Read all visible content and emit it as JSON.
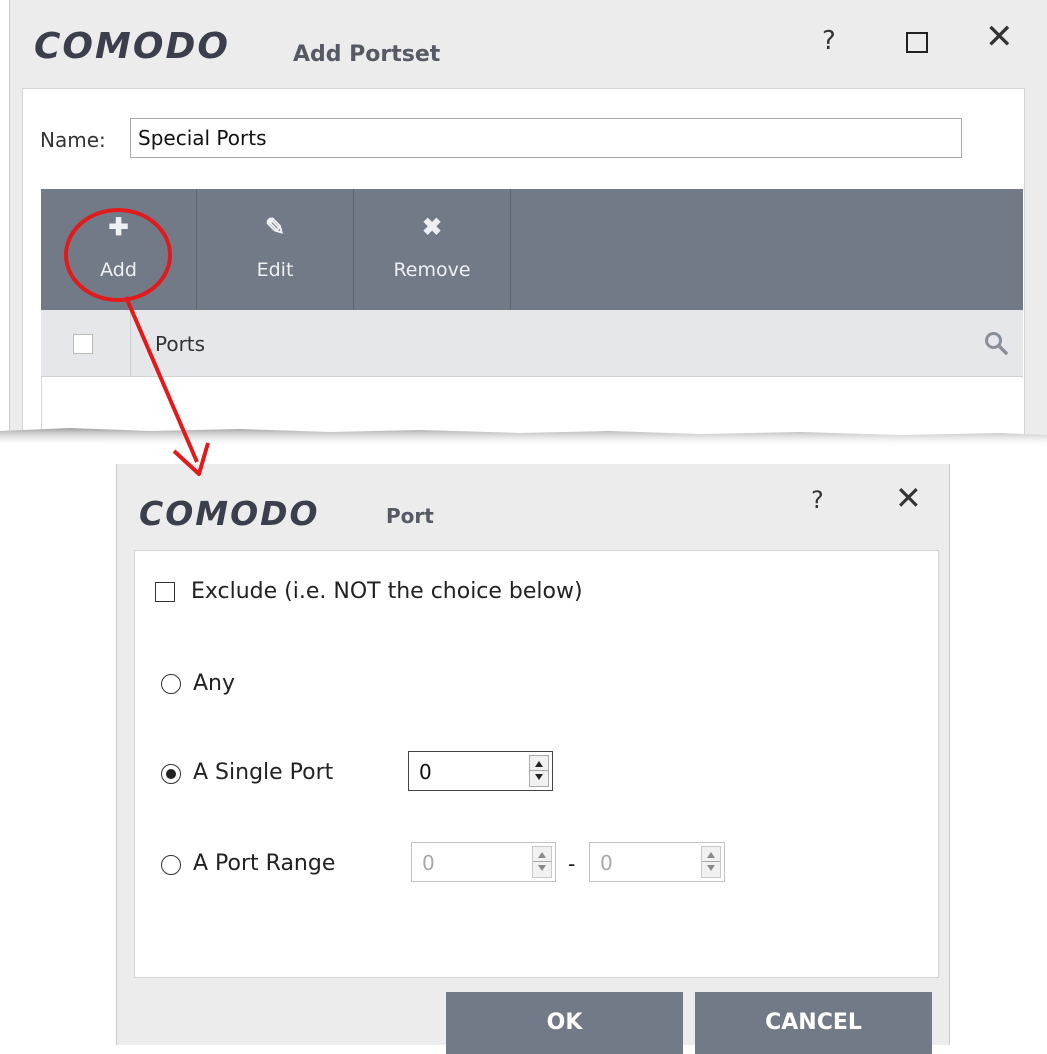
{
  "add_portset": {
    "brand": "COMODO",
    "title": "Add Portset",
    "help": "?",
    "close": "✕",
    "name_label": "Name:",
    "name_value": "Special Ports",
    "toolbar": [
      {
        "icon": "plus-icon",
        "glyph": "✚",
        "label": "Add"
      },
      {
        "icon": "pencil-icon",
        "glyph": "✎",
        "label": "Edit"
      },
      {
        "icon": "cross-icon",
        "glyph": "✖",
        "label": "Remove"
      }
    ],
    "column_header": "Ports"
  },
  "port_dialog": {
    "brand": "COMODO",
    "title": "Port",
    "help": "?",
    "close": "✕",
    "exclude_label": "Exclude (i.e. NOT the choice below)",
    "exclude_checked": false,
    "options": [
      {
        "label": "Any",
        "selected": false
      },
      {
        "label": "A Single Port",
        "selected": true
      },
      {
        "label": "A Port Range",
        "selected": false
      }
    ],
    "single_port_value": "0",
    "range_start_value": "0",
    "range_separator": "-",
    "range_end_value": "0",
    "ok_label": "OK",
    "cancel_label": "CANCEL"
  },
  "colors": {
    "toolbar": "#737a87",
    "annotation": "#e11b1b",
    "window_bg": "#ececec"
  }
}
